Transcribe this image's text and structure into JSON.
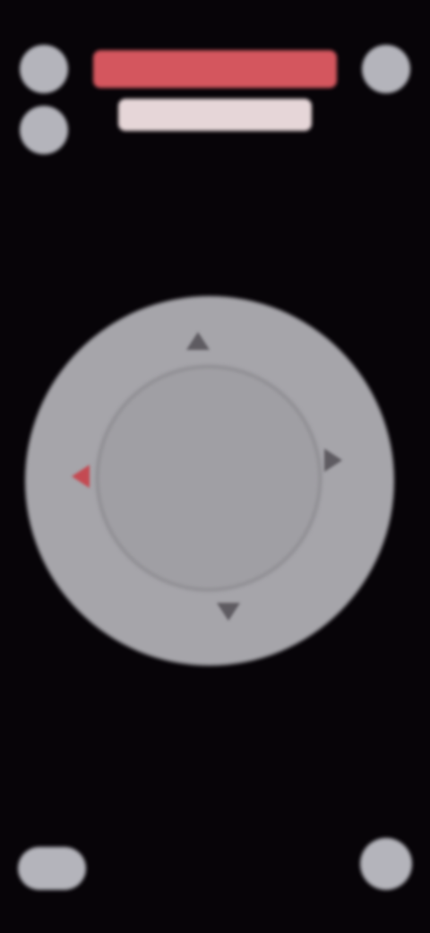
{
  "header": {
    "title_text": "",
    "subtitle_text": ""
  },
  "joystick": {
    "directions": [
      "up",
      "right",
      "down",
      "left"
    ]
  },
  "colors": {
    "background": "#070408",
    "button": "#b4b4bb",
    "title_bar": "#d4565e",
    "subtitle_bar": "#e6d6d8",
    "joystick_ring": "#a6a5aa",
    "joystick_knob": "#a09fa4",
    "arrow": "#5e5b61",
    "arrow_left": "#c44a52"
  },
  "icons": {
    "top_left_upper": "circle-button-icon",
    "top_left_lower": "circle-button-icon",
    "top_right": "circle-button-icon",
    "bottom_left": "pill-button-icon",
    "bottom_right": "circle-button-icon"
  }
}
